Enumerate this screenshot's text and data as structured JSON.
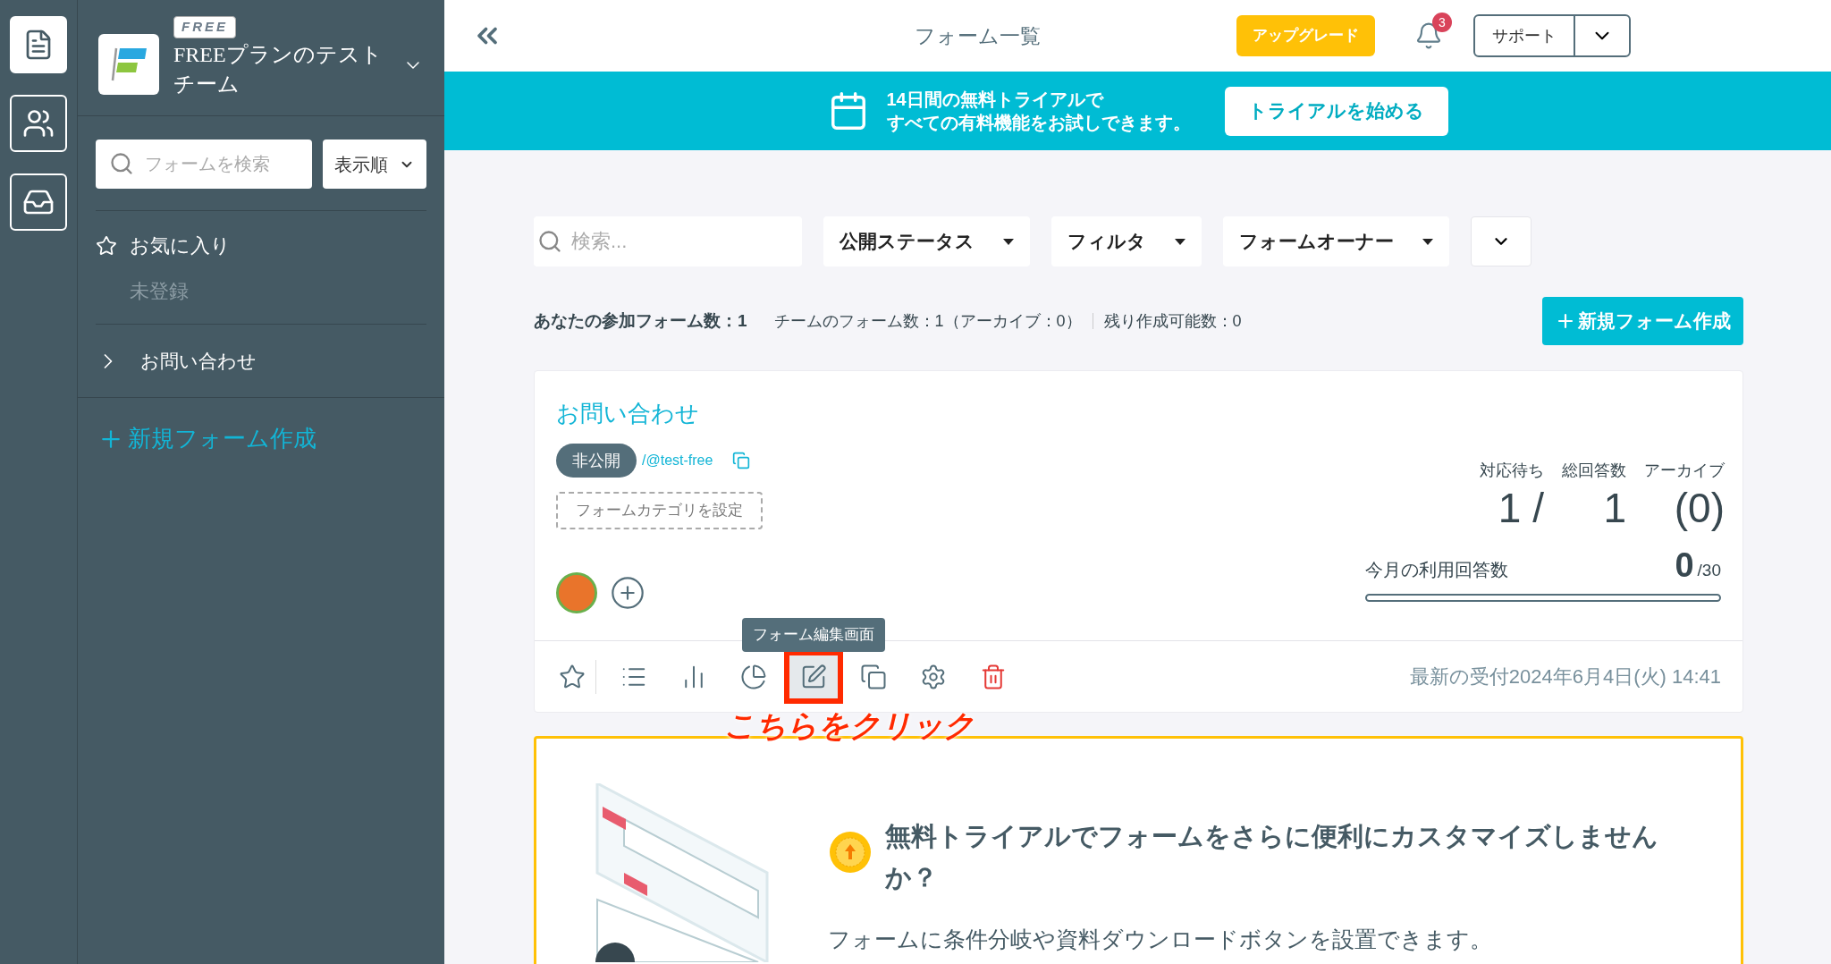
{
  "rail": [
    {
      "kind": "forms",
      "selected": true
    },
    {
      "kind": "team",
      "selected": false
    },
    {
      "kind": "inbox",
      "selected": false
    }
  ],
  "sidebar": {
    "plan_badge": "FREE",
    "team_name": "FREEプランのテストチーム",
    "search": {
      "placeholder": "フォームを検索"
    },
    "sort": "表示順",
    "favorites": {
      "label": "お気に入り",
      "empty": "未登録"
    },
    "folders": [
      {
        "label": "お問い合わせ",
        "expanded": false
      }
    ],
    "new_form": "新規フォーム作成"
  },
  "header": {
    "title": "フォーム一覧",
    "upgrade": "アップグレード",
    "notifications": "3",
    "support": "サポート"
  },
  "banner": {
    "lines": [
      "14日間の無料トライアルで",
      "すべての有料機能をお試しできます。"
    ],
    "button": "トライアルを始める"
  },
  "filters": {
    "search": {
      "placeholder": "検索..."
    },
    "dropdowns": [
      "公開ステータス",
      "フィルタ",
      "フォームオーナー"
    ]
  },
  "stats": {
    "mine": "あなたの参加フォーム数：1",
    "team": "チームのフォーム数：1（アーカイブ：0）",
    "remaining": "残り作成可能数：0",
    "new_form": "新規フォーム作成"
  },
  "card": {
    "title": "お問い合わせ",
    "status": "非公開",
    "url": "/@test-free",
    "category": "フォームカテゴリを設定",
    "counts": [
      {
        "label": "対応待ち",
        "value": "1 /"
      },
      {
        "label": "総回答数",
        "value": "1"
      },
      {
        "label": "アーカイブ",
        "value": "(0)"
      }
    ],
    "usage": {
      "label": "今月の利用回答数",
      "value": "0",
      "limit": "/30"
    },
    "actions": [
      {
        "kind": "star",
        "highlighted": false
      },
      {
        "kind": "list",
        "highlighted": false
      },
      {
        "kind": "chart",
        "highlighted": false
      },
      {
        "kind": "pie",
        "highlighted": false
      },
      {
        "kind": "edit",
        "highlighted": true,
        "tooltip": "フォーム編集画面"
      },
      {
        "kind": "copy",
        "highlighted": false
      },
      {
        "kind": "settings",
        "highlighted": false
      },
      {
        "kind": "delete",
        "highlighted": false
      }
    ],
    "latest": "最新の受付2024年6月4日(火) 14:41"
  },
  "annotation": "こちらをクリック",
  "promo": {
    "heading": "無料トライアルでフォームをさらに便利にカスタマイズしませんか？",
    "body": "フォームに条件分岐や資料ダウンロードボタンを設置できます。"
  }
}
